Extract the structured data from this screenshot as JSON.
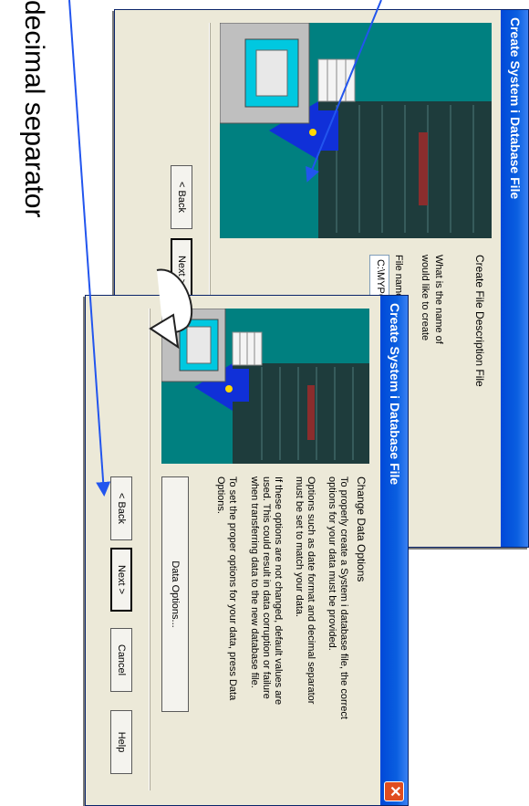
{
  "caption": "decimal separator",
  "dialog_back": {
    "title": "Create System i Database File",
    "close_glyph": "✕",
    "heading": "Create File Description File",
    "question_line1": "What is the name of",
    "question_line2": "would like to create",
    "file_name_label": "File name:",
    "file_name_value": "C:\\MYPCFILE.FDF",
    "back_label": "< Back",
    "next_label": "Next >"
  },
  "dialog_front": {
    "title": "Create System i Database File",
    "close_glyph": "✕",
    "heading": "Change Data Options",
    "para1_line1": "To properly create a System i database file, the correct",
    "para1_line2": "options for your data must be provided.",
    "para2_line1": "Options such as date format and decimal separator",
    "para2_line2": "must be set to match your data.",
    "para3_line1": "If these options are not changed, default values are",
    "para3_line2": "used.  This could result in data corruption or failure",
    "para3_line3": "when transferring data to the new database file.",
    "para4_line1": "To set the proper options for your data, press Data",
    "para4_line2": "Options.",
    "data_options_label": "Data Options...",
    "back_label": "< Back",
    "next_label": "Next >",
    "cancel_label": "Cancel",
    "help_label": "Help"
  },
  "colors": {
    "titlebar": "#0a5fe0",
    "dialog_bg": "#ece9d8",
    "art_bg": "#008080",
    "arrow": "#2255ee",
    "close": "#e04d1f"
  }
}
